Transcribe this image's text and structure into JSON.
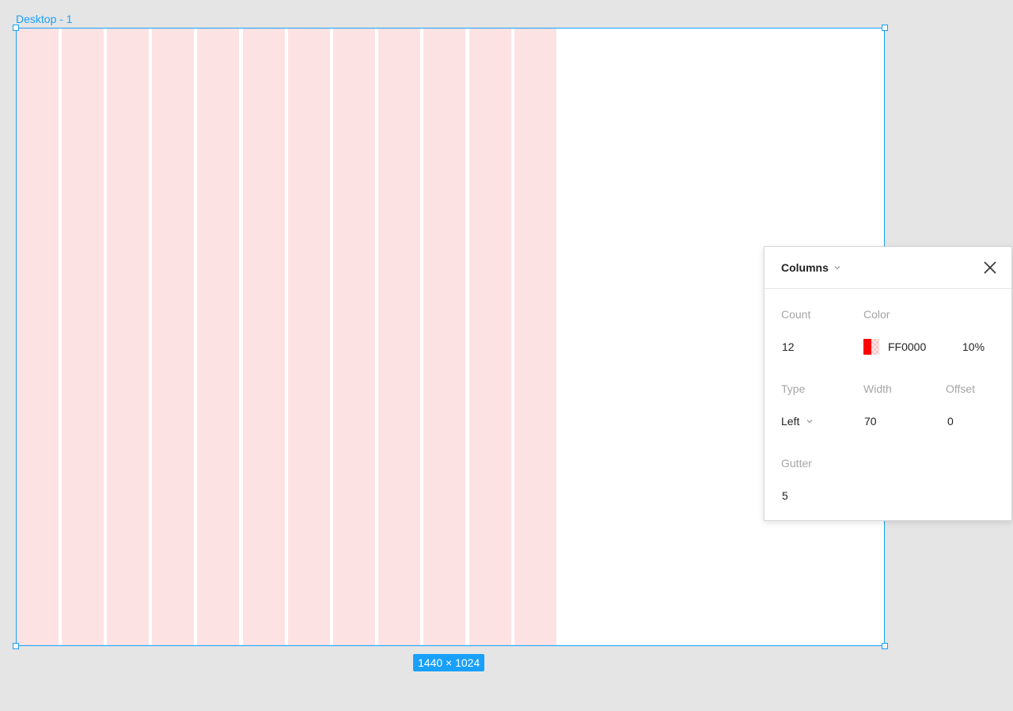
{
  "frame": {
    "name": "Desktop - 1",
    "size_label": "1440 × 1024"
  },
  "grid": {
    "column_color": "#fde2e4",
    "selection_color": "#18a0fb"
  },
  "columns_panel": {
    "title": "Columns",
    "count_label": "Count",
    "count_value": "12",
    "color_label": "Color",
    "color_hex": "FF0000",
    "color_opacity": "10%",
    "color_swatch": "#ff0000",
    "type_label": "Type",
    "type_value": "Left",
    "width_label": "Width",
    "width_value": "70",
    "offset_label": "Offset",
    "offset_value": "0",
    "gutter_label": "Gutter",
    "gutter_value": "5",
    "icons": {
      "title_dropdown": "chevron-down-icon",
      "type_dropdown": "chevron-down-icon",
      "close": "close-icon"
    }
  }
}
